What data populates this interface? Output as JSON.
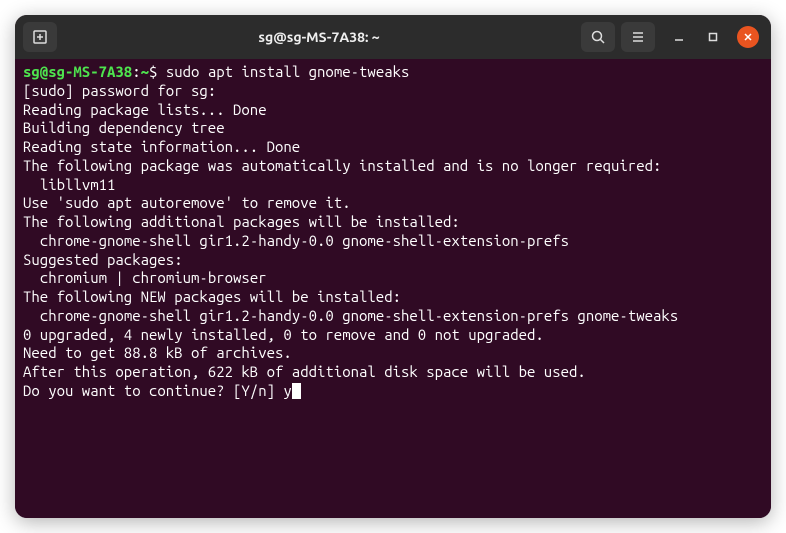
{
  "window": {
    "title": "sg@sg-MS-7A38: ~"
  },
  "prompt": {
    "user_host": "sg@sg-MS-7A38",
    "path": "~",
    "symbol": "$",
    "command": "sudo apt install gnome-tweaks"
  },
  "output": {
    "lines": [
      "[sudo] password for sg:",
      "Reading package lists... Done",
      "Building dependency tree",
      "Reading state information... Done",
      "The following package was automatically installed and is no longer required:",
      "  libllvm11",
      "Use 'sudo apt autoremove' to remove it.",
      "The following additional packages will be installed:",
      "  chrome-gnome-shell gir1.2-handy-0.0 gnome-shell-extension-prefs",
      "Suggested packages:",
      "  chromium | chromium-browser",
      "The following NEW packages will be installed:",
      "  chrome-gnome-shell gir1.2-handy-0.0 gnome-shell-extension-prefs gnome-tweaks",
      "0 upgraded, 4 newly installed, 0 to remove and 0 not upgraded.",
      "Need to get 88.8 kB of archives.",
      "After this operation, 622 kB of additional disk space will be used."
    ],
    "continue_prompt": "Do you want to continue? [Y/n] ",
    "continue_input": "y"
  }
}
